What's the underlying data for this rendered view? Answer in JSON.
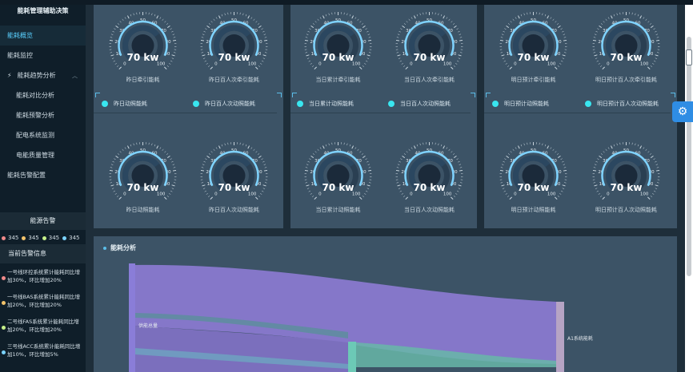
{
  "sidebar": {
    "title": "能耗管理辅助决策",
    "nav": [
      {
        "label": "能耗概览",
        "active": true
      },
      {
        "label": "能耗监控",
        "active": false
      },
      {
        "label": "能耗趋势分析",
        "active": false,
        "expanded": true
      }
    ],
    "sub_nav": [
      "能耗对比分析",
      "能耗预警分析",
      "配电系统监测",
      "电能质量管理"
    ],
    "nav_last": "能耗告警配置"
  },
  "alarm": {
    "title": "能源告警",
    "counts": [
      {
        "value": "345",
        "color": "#f08a8a"
      },
      {
        "value": "345",
        "color": "#f2c36b"
      },
      {
        "value": "345",
        "color": "#c6f08a"
      },
      {
        "value": "345",
        "color": "#7ad2ff"
      }
    ]
  },
  "alert_info": {
    "title": "当前告警信息",
    "items": [
      {
        "text": "一号线环控系统累计能耗同比增加30%，环比增加20%",
        "color": "#f08a8a"
      },
      {
        "text": "一号线BAS系统累计能耗同比增加20%，环比增加20%",
        "color": "#f2c36b"
      },
      {
        "text": "二号线FAS系统累计能耗同比增加20%，环比增加20%",
        "color": "#c6f08a"
      },
      {
        "text": "三号线ACC系统累计能耗同比增加10%，环比增加5%",
        "color": "#7ad2ff"
      }
    ]
  },
  "gauges": {
    "ticks": [
      "0",
      "10",
      "20",
      "30",
      "40",
      "50",
      "60",
      "70",
      "80",
      "90",
      "100"
    ],
    "value": 70,
    "unit": "kw",
    "display": "70 kw",
    "row1": [
      "昨日牵引能耗",
      "昨日百人次牵引能耗",
      "当日累计牵引能耗",
      "当日百人次牵引能耗",
      "明日预计牵引能耗",
      "明日预计百人次牵引能耗"
    ],
    "row2": [
      "昨日动照能耗",
      "昨日百人次动照能耗",
      "当日累计动照能耗",
      "当日百人次动照能耗",
      "明日预计动照能耗",
      "明日预计百人次动照能耗"
    ]
  },
  "legends": [
    "昨日动照能耗",
    "昨日百人次动照能耗",
    "当日累计动照能耗",
    "当日百人次动照能耗",
    "明日预计动照能耗",
    "明日预计百人次动照能耗"
  ],
  "sankey": {
    "title": "能耗分析",
    "source_label": "供能总量",
    "target_label": "A1系统能耗",
    "colors": {
      "source": "#8a7dd8",
      "flow": "#8577c9",
      "mid": "#6cc9b6",
      "target": "#b6a4c4"
    }
  },
  "colors": {
    "accent": "#5ad0ff",
    "gauge_arc": "#7fd3ff",
    "legend_dot": "#39e6f0"
  }
}
